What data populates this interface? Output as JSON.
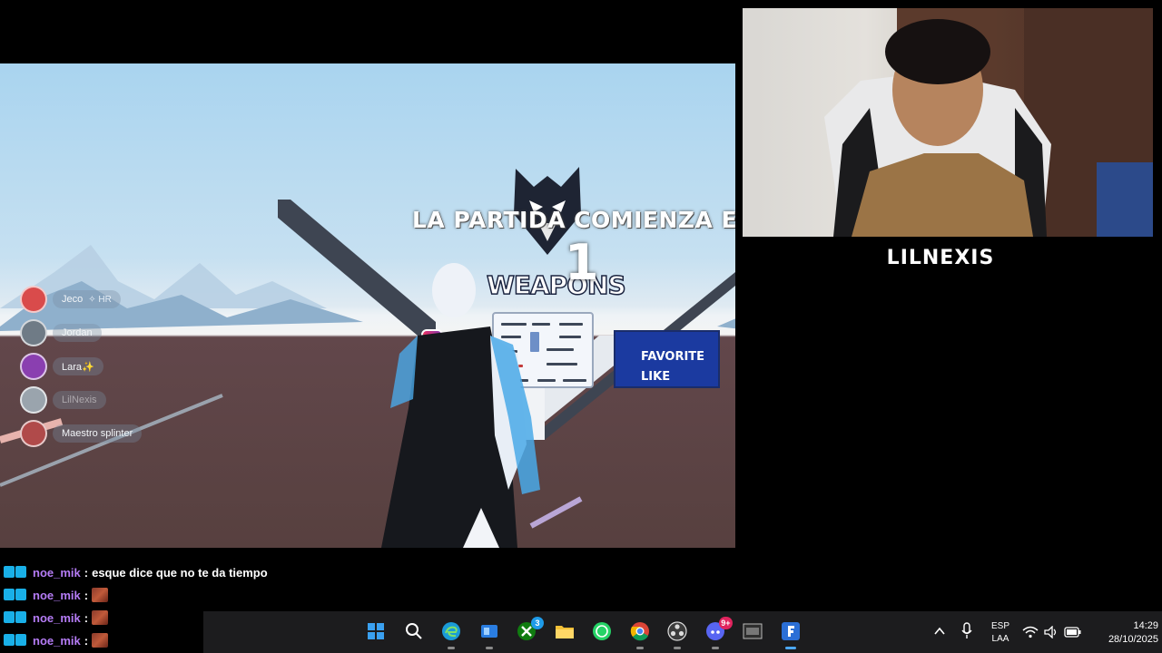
{
  "game": {
    "countdown_title": "LA PARTIDA COMIENZA EN",
    "countdown_number": "1",
    "weapons_label": "WEAPONS",
    "promo": {
      "line1": "FAVORITE",
      "line2": "LIKE"
    },
    "party": [
      {
        "name": "Jeco",
        "extra": "✧ HR",
        "avatar_color": "#d94b4b",
        "dim": false
      },
      {
        "name": "Jordan",
        "extra": "",
        "avatar_color": "#6f7b86",
        "dim": false
      },
      {
        "name": "Lara✨",
        "extra": "",
        "avatar_color": "#8a3fb0",
        "dim": false
      },
      {
        "name": "LilNexis",
        "extra": "",
        "avatar_color": "#9aa4ad",
        "dim": true
      },
      {
        "name": "Maestro splinter",
        "extra": "",
        "avatar_color": "#b04a4a",
        "dim": false
      }
    ]
  },
  "webcam": {
    "name": "LILNEXIS"
  },
  "chat": {
    "messages": [
      {
        "user": "noe_mik",
        "text": "esque dice que no te da tiempo",
        "emote": false
      },
      {
        "user": "noe_mik",
        "text": "",
        "emote": true
      },
      {
        "user": "noe_mik",
        "text": "",
        "emote": true
      },
      {
        "user": "noe_mik",
        "text": "",
        "emote": true
      }
    ]
  },
  "taskbar": {
    "apps": [
      {
        "name": "windows-start",
        "icon": "windows-icon",
        "color": "#2f8fe0"
      },
      {
        "name": "search",
        "icon": "search-icon",
        "color": "transparent"
      },
      {
        "name": "edge",
        "icon": "edge-icon",
        "color": "#1a9bd7"
      },
      {
        "name": "widgets",
        "icon": "widgets-icon",
        "color": "#2a7de1"
      },
      {
        "name": "xbox",
        "icon": "xbox-icon",
        "color": "#107c10",
        "badge": "3"
      },
      {
        "name": "file-explorer",
        "icon": "folder-icon",
        "color": "#f2c037"
      },
      {
        "name": "whatsapp",
        "icon": "whatsapp-icon",
        "color": "#25d366"
      },
      {
        "name": "chrome",
        "icon": "chrome-icon",
        "color": "#db4437"
      },
      {
        "name": "obs",
        "icon": "obs-icon",
        "color": "#3c3c3c"
      },
      {
        "name": "discord",
        "icon": "discord-icon",
        "color": "#5865f2",
        "badge": "9+"
      },
      {
        "name": "gta",
        "icon": "gta-icon",
        "color": "#2e2e2e"
      },
      {
        "name": "fortnite",
        "icon": "fortnite-icon",
        "color": "#2b6fd6",
        "active": true
      }
    ],
    "language": {
      "line1": "ESP",
      "line2": "LAA"
    },
    "time": "14:29",
    "date": "28/10/2025"
  }
}
